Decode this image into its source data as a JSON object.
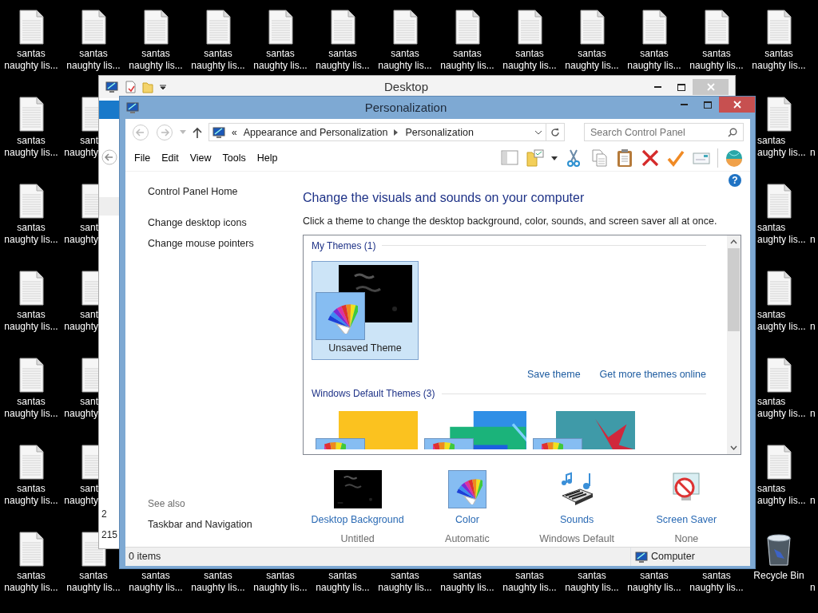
{
  "desktop": {
    "rows": [
      {
        "left": [
          {
            "kind": "file",
            "label_lines": [
              "santas",
              "naughty lis..."
            ]
          },
          {
            "kind": "file",
            "label_lines": [
              "santas",
              "naughty lis..."
            ]
          },
          {
            "kind": "file",
            "label_lines": [
              "santas",
              "naughty lis..."
            ]
          },
          {
            "kind": "file",
            "label_lines": [
              "santas",
              "naughty lis..."
            ]
          },
          {
            "kind": "file",
            "label_lines": [
              "santas",
              "naughty lis..."
            ]
          },
          {
            "kind": "file",
            "label_lines": [
              "santas",
              "naughty lis..."
            ]
          },
          {
            "kind": "file",
            "label_lines": [
              "santas",
              "naughty lis..."
            ]
          },
          {
            "kind": "file",
            "label_lines": [
              "santas",
              "naughty lis..."
            ]
          },
          {
            "kind": "file",
            "label_lines": [
              "santas",
              "naughty lis..."
            ]
          },
          {
            "kind": "file",
            "label_lines": [
              "santas",
              "naughty lis..."
            ]
          },
          {
            "kind": "file",
            "label_lines": [
              "santas",
              "naughty lis..."
            ]
          },
          {
            "kind": "file",
            "label_lines": [
              "santas",
              "naughty lis..."
            ]
          },
          {
            "kind": "file",
            "label_lines": [
              "santas",
              "naughty lis..."
            ]
          }
        ],
        "right": []
      },
      {
        "left": [
          {
            "kind": "file",
            "label_lines": [
              "santas",
              "naughty lis..."
            ]
          },
          {
            "kind": "clip_right",
            "label_lines": [
              "sant",
              "naughty"
            ]
          }
        ],
        "right": [
          {
            "kind": "clip_left",
            "label_lines": [
              "santas",
              "aughty lis..."
            ]
          },
          {
            "kind": "edge",
            "label_lines": [
              "n"
            ]
          }
        ]
      },
      {
        "left": [
          {
            "kind": "file",
            "label_lines": [
              "santas",
              "naughty lis..."
            ]
          },
          {
            "kind": "clip_right",
            "label_lines": [
              "sant",
              "naughty"
            ]
          }
        ],
        "right": [
          {
            "kind": "clip_left",
            "label_lines": [
              "santas",
              "aughty lis..."
            ]
          },
          {
            "kind": "edge",
            "label_lines": [
              "n"
            ]
          }
        ]
      },
      {
        "left": [
          {
            "kind": "file",
            "label_lines": [
              "santas",
              "naughty lis..."
            ]
          },
          {
            "kind": "clip_right",
            "label_lines": [
              "sant",
              "naughty"
            ]
          }
        ],
        "right": [
          {
            "kind": "clip_left",
            "label_lines": [
              "santas",
              "aughty lis..."
            ]
          },
          {
            "kind": "edge",
            "label_lines": [
              "n"
            ]
          }
        ]
      },
      {
        "left": [
          {
            "kind": "file",
            "label_lines": [
              "santas",
              "naughty lis..."
            ]
          },
          {
            "kind": "clip_right",
            "label_lines": [
              "sant",
              "naughty"
            ]
          }
        ],
        "right": [
          {
            "kind": "clip_left",
            "label_lines": [
              "santas",
              "aughty lis..."
            ]
          },
          {
            "kind": "edge",
            "label_lines": [
              "n"
            ]
          }
        ]
      },
      {
        "left": [
          {
            "kind": "file",
            "label_lines": [
              "santas",
              "naughty lis..."
            ]
          },
          {
            "kind": "clip_right",
            "label_lines": [
              "sant",
              "naughty"
            ]
          }
        ],
        "right": [
          {
            "kind": "clip_left",
            "label_lines": [
              "santas",
              "aughty lis..."
            ]
          },
          {
            "kind": "edge",
            "label_lines": [
              "n"
            ]
          }
        ]
      },
      {
        "left": [
          {
            "kind": "file",
            "label_lines": [
              "santas",
              "naughty lis..."
            ]
          },
          {
            "kind": "file",
            "label_lines": [
              "santas",
              "naughty lis..."
            ]
          },
          {
            "kind": "label",
            "label_lines": [
              "santas",
              "naughty lis..."
            ]
          },
          {
            "kind": "label",
            "label_lines": [
              "santas",
              "naughty lis..."
            ]
          },
          {
            "kind": "label",
            "label_lines": [
              "santas",
              "naughty lis..."
            ]
          },
          {
            "kind": "label",
            "label_lines": [
              "santas",
              "naughty lis..."
            ]
          },
          {
            "kind": "label",
            "label_lines": [
              "santas",
              "naughty lis..."
            ]
          },
          {
            "kind": "label",
            "label_lines": [
              "santas",
              "naughty lis..."
            ]
          },
          {
            "kind": "label",
            "label_lines": [
              "santas",
              "naughty lis..."
            ]
          },
          {
            "kind": "label",
            "label_lines": [
              "santas",
              "naughty lis..."
            ]
          },
          {
            "kind": "label",
            "label_lines": [
              "santas",
              "naughty lis..."
            ]
          },
          {
            "kind": "label",
            "label_lines": [
              "santas",
              "naughty lis..."
            ]
          }
        ],
        "right": [
          {
            "kind": "recycle_bin",
            "label_lines": [
              "Recycle Bin"
            ]
          },
          {
            "kind": "edge",
            "label_lines": [
              "n"
            ]
          }
        ]
      }
    ]
  },
  "background_window": {
    "title": "Desktop",
    "status_texts": [
      "2",
      "215"
    ]
  },
  "window": {
    "title": "Personalization",
    "address": {
      "overflow": "«",
      "crumbs": [
        "Appearance and Personalization",
        "Personalization"
      ]
    },
    "search": {
      "placeholder": "Search Control Panel"
    },
    "menu": [
      "File",
      "Edit",
      "View",
      "Tools",
      "Help"
    ],
    "sidebar": {
      "links": [
        "Control Panel Home",
        "Change desktop icons",
        "Change mouse pointers"
      ],
      "see_also_heading": "See also",
      "see_also_links": [
        "Taskbar and Navigation"
      ]
    },
    "help": "?",
    "heading": "Change the visuals and sounds on your computer",
    "description": "Click a theme to change the desktop background, color, sounds, and screen saver all at once.",
    "theme_groups": [
      {
        "title": "My Themes (1)",
        "themes": [
          {
            "name": "Unsaved Theme",
            "selected": true
          }
        ],
        "links": [
          "Save theme",
          "Get more themes online"
        ]
      },
      {
        "title": "Windows Default Themes (3)",
        "themes": [
          {
            "selected": false
          },
          {
            "selected": false
          },
          {
            "selected": false
          }
        ]
      }
    ],
    "settings": [
      {
        "kind": "background",
        "label": "Desktop Background",
        "value": "Untitled"
      },
      {
        "kind": "color",
        "label": "Color",
        "value": "Automatic"
      },
      {
        "kind": "sounds",
        "label": "Sounds",
        "value": "Windows Default"
      },
      {
        "kind": "screen_saver",
        "label": "Screen Saver",
        "value": "None"
      }
    ],
    "status_bar": {
      "items": "0 items",
      "location": "Computer"
    }
  }
}
